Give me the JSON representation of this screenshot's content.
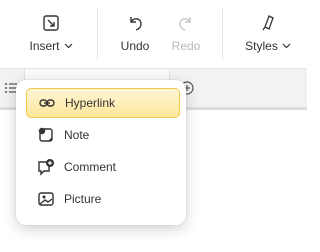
{
  "toolbar": {
    "truncated_label": "r",
    "insert_label": "Insert",
    "undo_label": "Undo",
    "redo_label": "Redo",
    "styles_label": "Styles"
  },
  "insert_menu": {
    "items": [
      {
        "label": "Hyperlink",
        "icon": "link-icon",
        "selected": true
      },
      {
        "label": "Note",
        "icon": "note-icon",
        "selected": false
      },
      {
        "label": "Comment",
        "icon": "comment-icon",
        "selected": false
      },
      {
        "label": "Picture",
        "icon": "picture-icon",
        "selected": false
      }
    ]
  },
  "colors": {
    "highlight_top": "#fff6d6",
    "highlight_bottom": "#fde79a",
    "highlight_border": "#f0c84a",
    "disabled_text": "#b9b9b9"
  }
}
